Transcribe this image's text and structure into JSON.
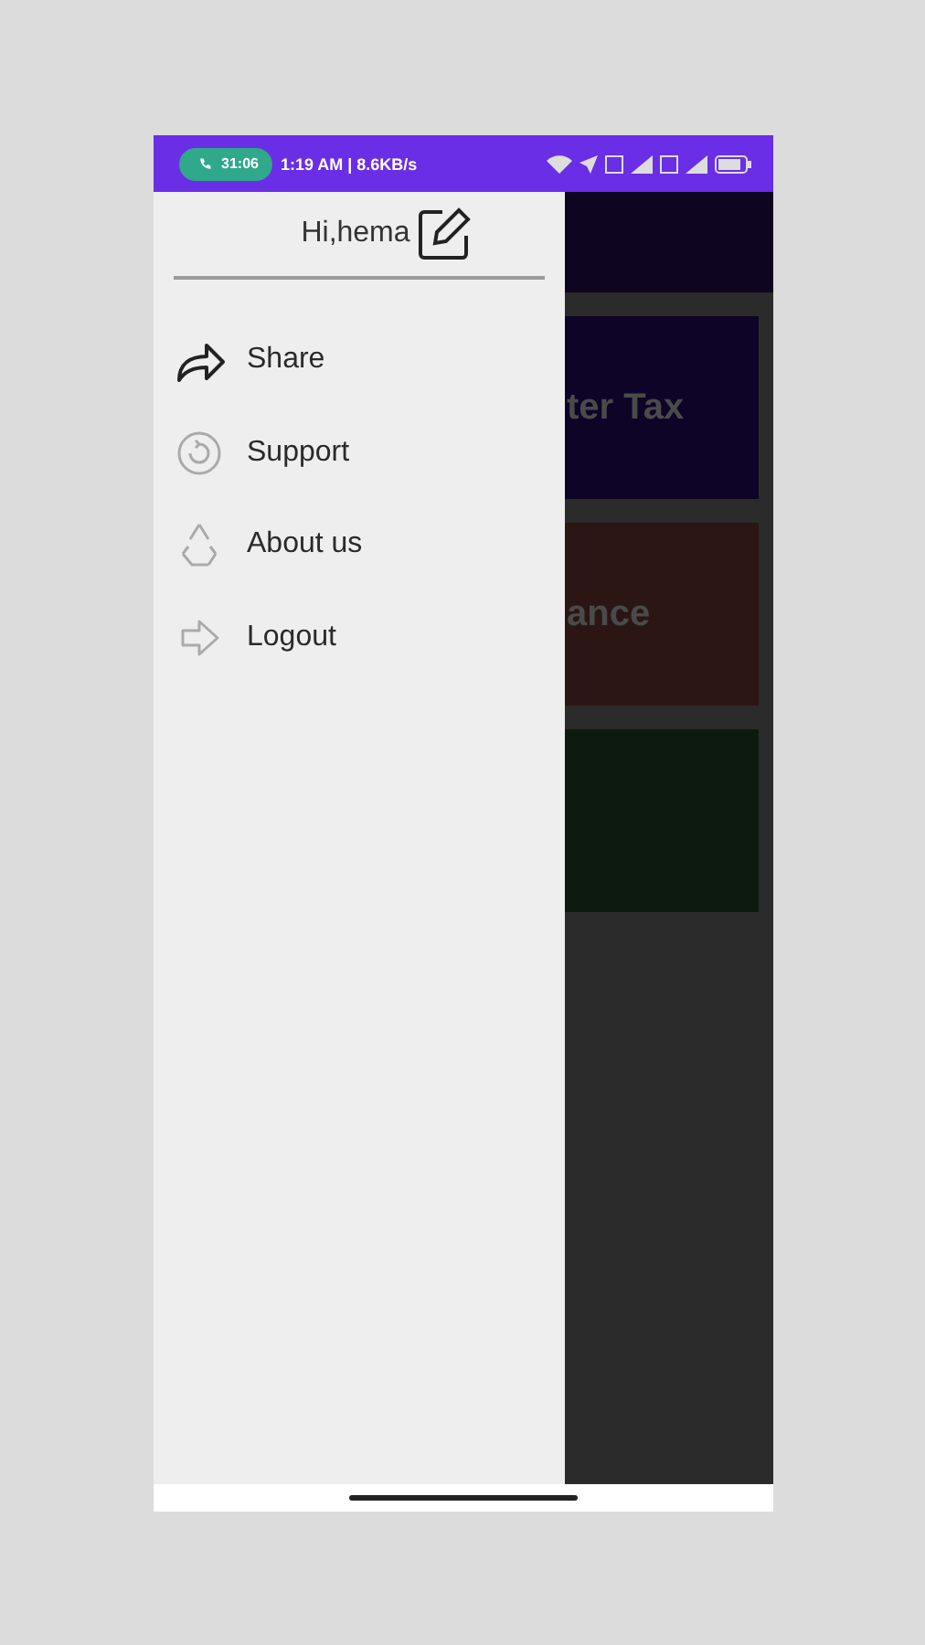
{
  "status_bar": {
    "call_timer": "31:06",
    "time_and_speed": "1:19 AM | 8.6KB/s"
  },
  "drawer": {
    "greeting": "Hi,hema",
    "items": [
      {
        "kind": "share",
        "label": "Share"
      },
      {
        "kind": "support",
        "label": "Support"
      },
      {
        "kind": "about",
        "label": "About us"
      },
      {
        "kind": "logout",
        "label": "Logout"
      }
    ]
  },
  "background_cards": [
    {
      "label": "ter Tax",
      "color": "#0d0428"
    },
    {
      "label": "ance",
      "color": "#2b1614"
    },
    {
      "color": "#0d1a10"
    }
  ]
}
